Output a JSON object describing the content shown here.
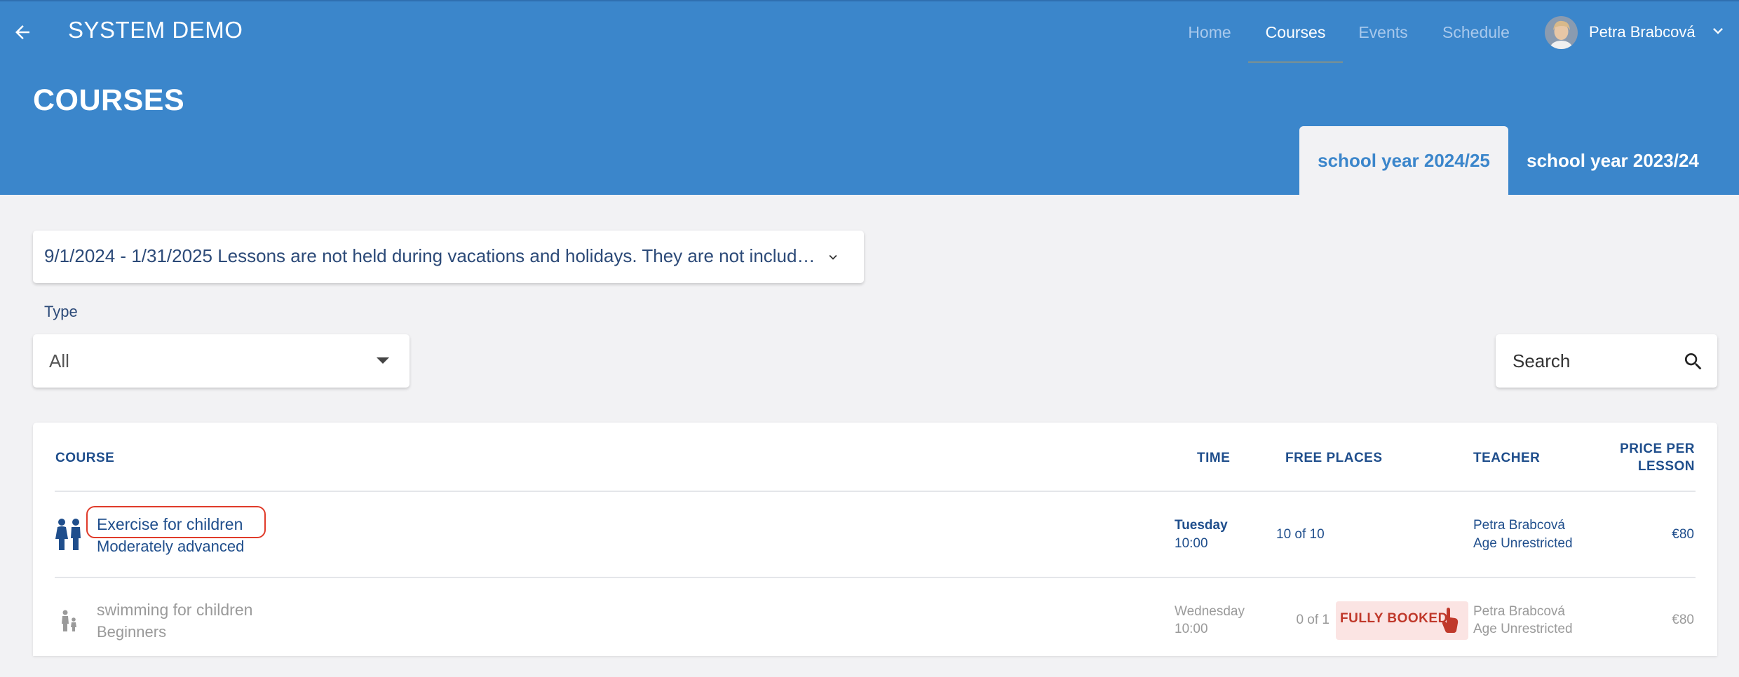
{
  "appbar": {
    "back_icon": "arrow-left-icon",
    "title": "SYSTEM DEMO",
    "nav": [
      {
        "label": "Home",
        "active": false
      },
      {
        "label": "Courses",
        "active": true
      },
      {
        "label": "Events",
        "active": false
      },
      {
        "label": "Schedule",
        "active": false
      }
    ],
    "user_name": "Petra Brabcová",
    "user_menu_icon": "chevron-down-icon"
  },
  "header": {
    "title": "COURSES",
    "tabs": [
      {
        "label": "school year 2024/25",
        "active": true
      },
      {
        "label": "school year 2023/24",
        "active": false
      }
    ]
  },
  "filters": {
    "period": "9/1/2024 - 1/31/2025 Lessons are not held during vacations and holidays. They are not includ…",
    "type_label": "Type",
    "type_value": "All",
    "search_placeholder": "Search"
  },
  "table": {
    "columns": {
      "course": "COURSE",
      "time": "TIME",
      "free_places": "FREE PLACES",
      "teacher": "TEACHER",
      "price_line1": "PRICE PER",
      "price_line2": "LESSON"
    },
    "rows": [
      {
        "icon": "children-icon",
        "name": "Exercise for children",
        "level": "Moderately advanced",
        "day": "Tuesday",
        "time": "10:00",
        "free": "10 of 10",
        "teacher": "Petra Brabcová",
        "age": "Age Unrestricted",
        "price": "€80",
        "highlighted": true
      },
      {
        "icon": "parent-child-icon",
        "name": "swimming for children",
        "level": "Beginners",
        "day": "Wednesday",
        "time": "10:00",
        "free": "0 of 1",
        "badge": "FULLY BOOKED",
        "teacher": "Petra Brabcová",
        "age": "Age Unrestricted",
        "price": "€80",
        "disabled": true
      }
    ]
  },
  "colors": {
    "primary": "#3b86cb",
    "accent": "#f5a623",
    "text_dark_blue": "#1f4e8c",
    "booked_red": "#c0392b",
    "highlight_ring": "#e03b2a"
  }
}
